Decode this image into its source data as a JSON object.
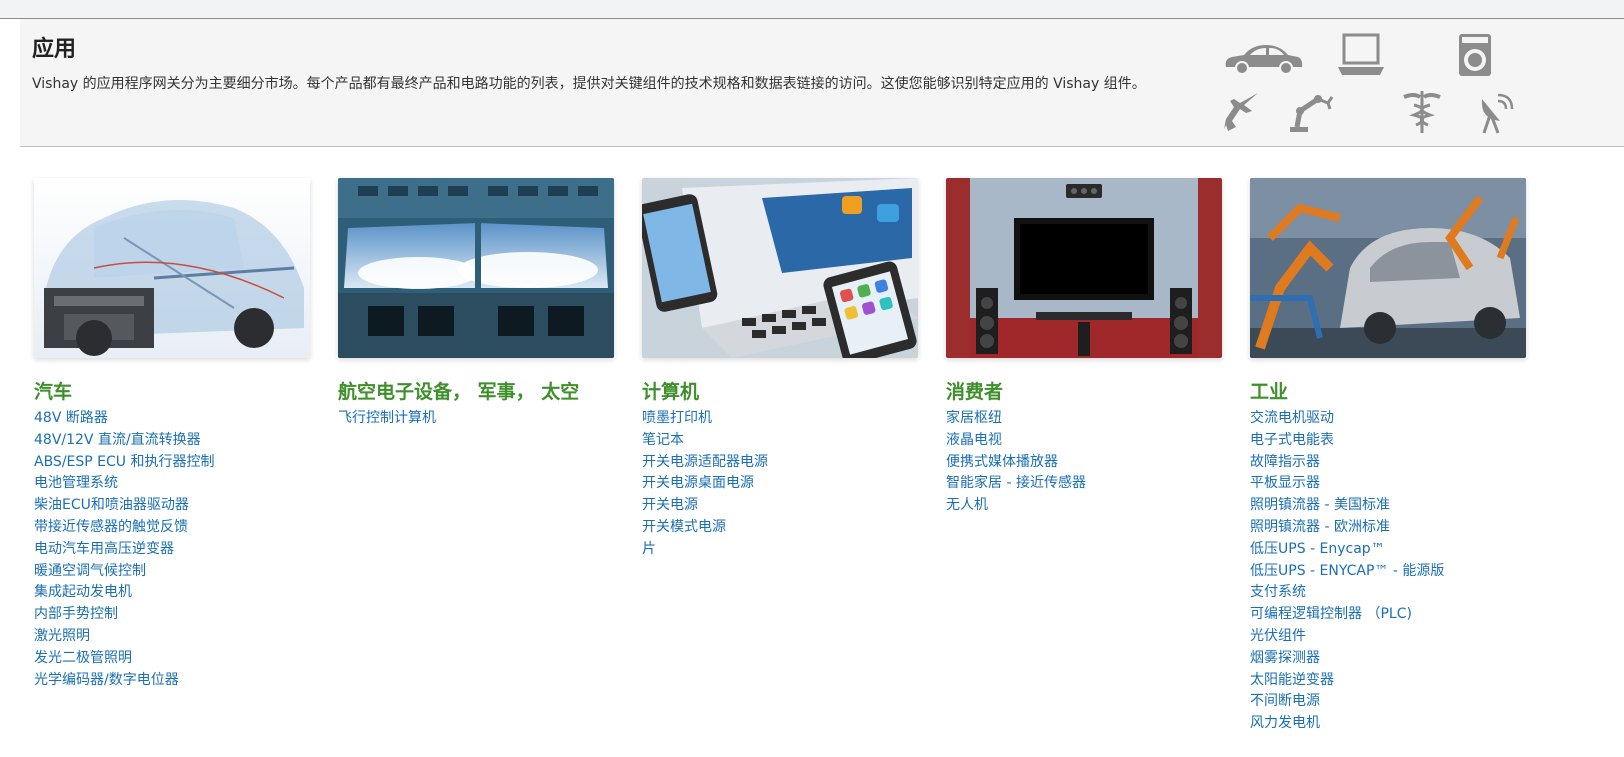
{
  "intro": {
    "title": "应用",
    "description": "Vishay 的应用程序网关分为主要细分市场。每个产品都有最终产品和电路功能的列表，提供对关键组件的技术规格和数据表链接的访问。这使您能够识别特定应用的 Vishay 组件。",
    "icons": [
      "car-icon",
      "laptop-icon",
      "washing-machine-icon",
      "fighter-jet-icon",
      "robot-arm-icon",
      "caduceus-icon",
      "satellite-dish-icon"
    ]
  },
  "colors": {
    "heading_green": "#3f8f2b",
    "link_blue": "#1a6fb5",
    "icon_gray": "#8c8c8c"
  },
  "categories": [
    {
      "title": "汽车",
      "image": "automotive-photo",
      "items": [
        "48V 断路器",
        "48V/12V 直流/直流转换器",
        "ABS/ESP ECU 和执行器控制",
        "电池管理系统",
        "柴油ECU和喷油器驱动器",
        "带接近传感器的触觉反馈",
        "电动汽车用高压逆变器",
        "暖通空调气候控制",
        "集成起动发电机",
        "内部手势控制",
        "激光照明",
        "发光二极管照明",
        "光学编码器/数字电位器"
      ]
    },
    {
      "title": "航空电子设备， 军事， 太空",
      "image": "cockpit-photo",
      "items": [
        "飞行控制计算机"
      ]
    },
    {
      "title": "计算机",
      "image": "computer-devices-photo",
      "items": [
        "喷墨打印机",
        "笔记本",
        "开关电源适配器电源",
        "开关电源桌面电源",
        "开关电源",
        "开关模式电源",
        "片"
      ]
    },
    {
      "title": "消费者",
      "image": "home-theater-photo",
      "items": [
        "家居枢纽",
        "液晶电视",
        "便携式媒体播放器",
        "智能家居 - 接近传感器",
        "无人机"
      ]
    },
    {
      "title": "工业",
      "image": "factory-robots-photo",
      "items": [
        "交流电机驱动",
        "电子式电能表",
        "故障指示器",
        "平板显示器",
        "照明镇流器 - 美国标准",
        "照明镇流器 - 欧洲标准",
        "低压UPS - Enycap™",
        "低压UPS - ENYCAP™ - 能源版",
        "支付系统",
        "可编程逻辑控制器 （PLC)",
        "光伏组件",
        "烟雾探测器",
        "太阳能逆变器",
        "不间断电源",
        "风力发电机"
      ]
    }
  ]
}
